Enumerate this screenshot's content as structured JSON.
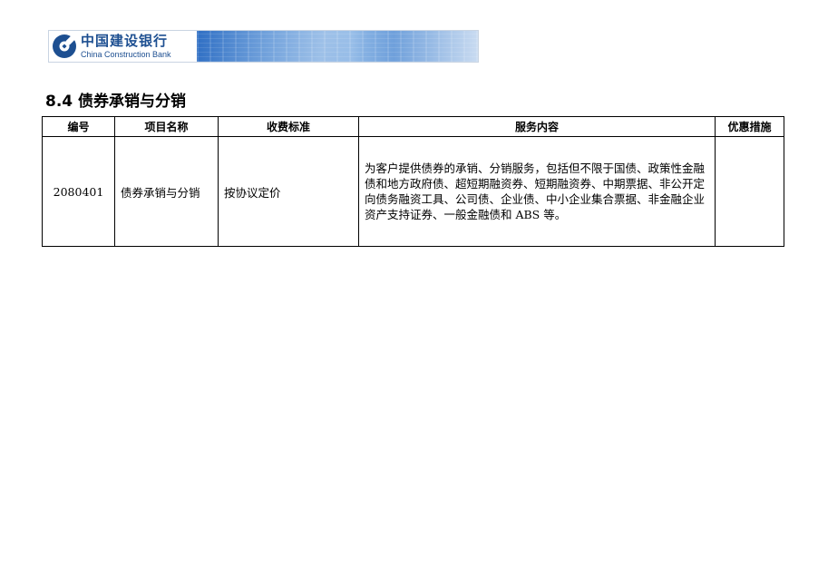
{
  "header": {
    "logo_cn": "中国建设银行",
    "logo_en": "China Construction Bank",
    "brand_color": "#1d4f91"
  },
  "section": {
    "title": "8.4 债券承销与分销"
  },
  "table": {
    "columns": [
      "编号",
      "项目名称",
      "收费标准",
      "服务内容",
      "优惠措施"
    ],
    "rows": [
      {
        "code": "2080401",
        "name": "债券承销与分销",
        "fee": "按协议定价",
        "content": "为客户提供债券的承销、分销服务，包括但不限于国债、政策性金融债和地方政府债、超短期融资券、短期融资券、中期票据、非公开定向债务融资工具、公司债、企业债、中小企业集合票据、非金融企业资产支持证券、一般金融债和 ABS 等。",
        "discount": ""
      }
    ]
  }
}
